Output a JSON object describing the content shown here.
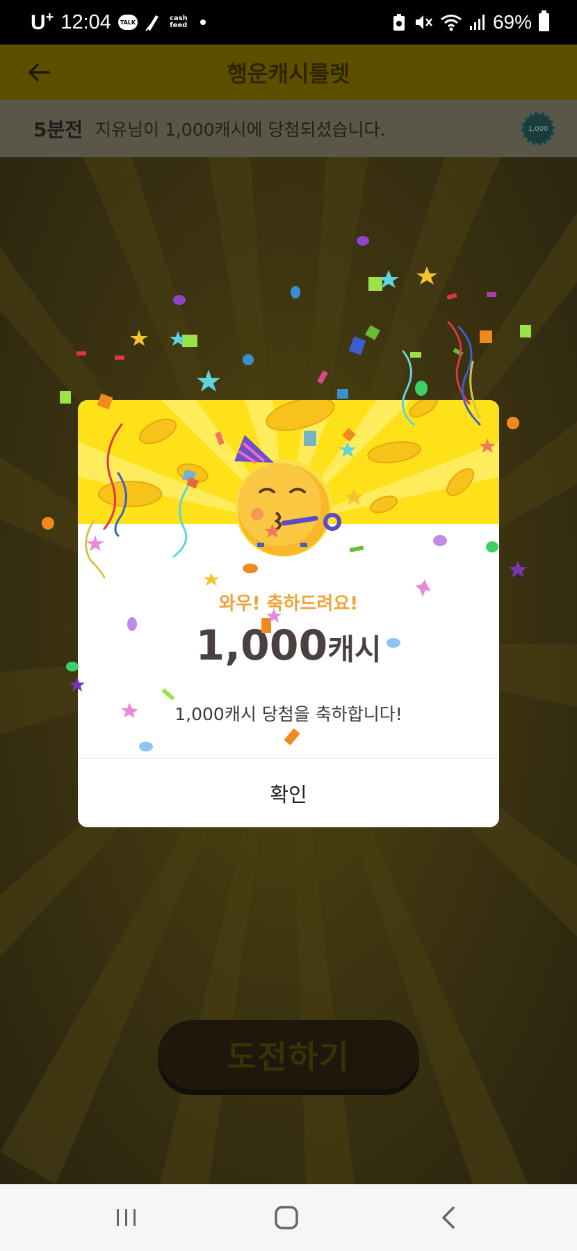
{
  "status_bar": {
    "carrier": "U",
    "carrier_sup": "+",
    "time": "12:04",
    "talk_badge": "TALK",
    "cash_line1": "cash",
    "cash_line2": "feed",
    "battery": "69%"
  },
  "app_bar": {
    "title": "행운캐시룰렛"
  },
  "ticker": {
    "time": "5분전",
    "message": "지유님이 1,000캐시에 당첨되셨습니다.",
    "coin_label": "1,000"
  },
  "main": {
    "challenge_label": "도전하기"
  },
  "dialog": {
    "congrats": "와우! 축하드려요!",
    "amount_number": "1,000",
    "amount_unit": "캐시",
    "message": "1,000캐시 당첨을 축하합니다!",
    "confirm_label": "확인"
  },
  "colors": {
    "accent_yellow": "#ffe11a",
    "congrats_orange": "#f0a33a",
    "amount_text": "#4a4040"
  },
  "icons": {
    "back": "arrow-left-icon",
    "nav_recent": "recent-apps-icon",
    "nav_home": "home-icon",
    "nav_back": "chevron-left-icon",
    "emoji": "partying-face-icon"
  }
}
